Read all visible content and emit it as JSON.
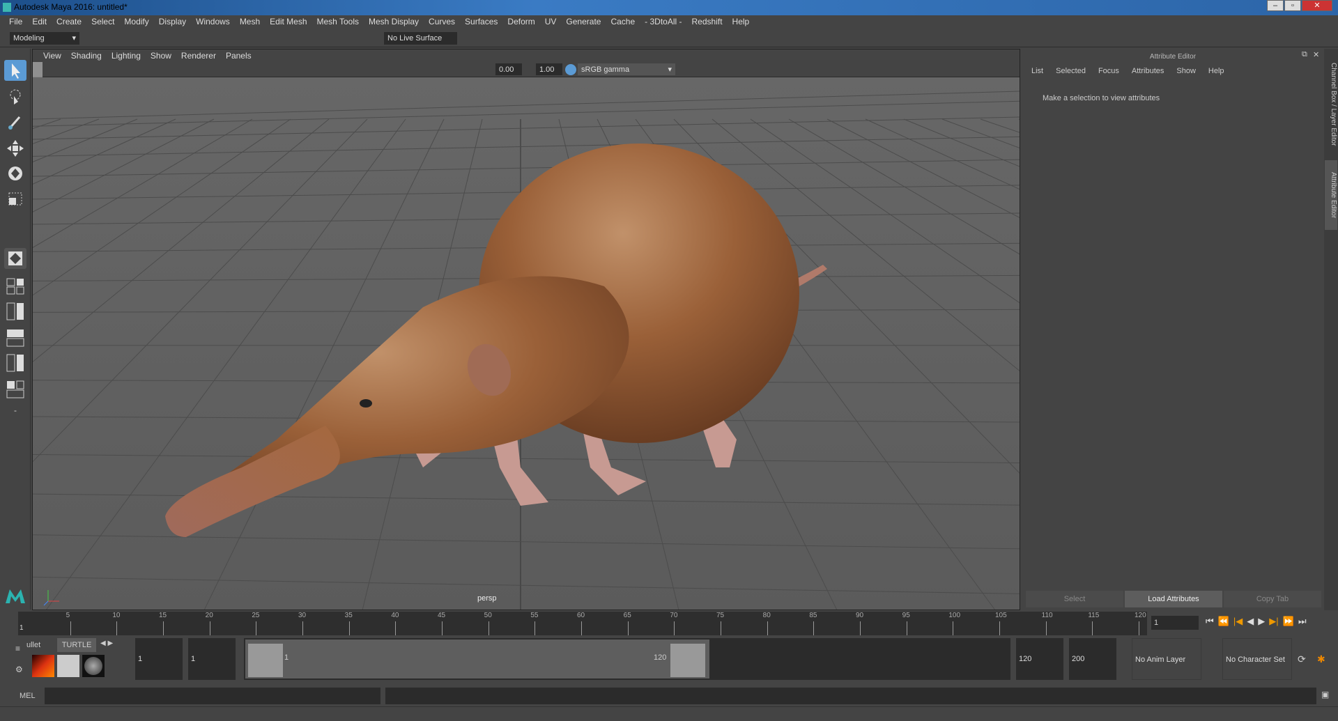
{
  "window": {
    "title": "Autodesk Maya 2016: untitled*",
    "minimize": "–",
    "maximize": "▫",
    "close": "✕"
  },
  "menubar": [
    "File",
    "Edit",
    "Create",
    "Select",
    "Modify",
    "Display",
    "Windows",
    "Mesh",
    "Edit Mesh",
    "Mesh Tools",
    "Mesh Display",
    "Curves",
    "Surfaces",
    "Deform",
    "UV",
    "Generate",
    "Cache",
    "- 3DtoAll -",
    "Redshift",
    "Help"
  ],
  "toolbar": {
    "mode": "Modeling",
    "live_surface": "No Live Surface"
  },
  "viewport": {
    "menu": [
      "View",
      "Shading",
      "Lighting",
      "Show",
      "Renderer",
      "Panels"
    ],
    "exposure": "0.00",
    "gamma": "1.00",
    "color_space": "sRGB gamma",
    "camera": "persp"
  },
  "attribute_editor": {
    "title": "Attribute Editor",
    "menu": [
      "List",
      "Selected",
      "Focus",
      "Attributes",
      "Show",
      "Help"
    ],
    "message": "Make a selection to view attributes",
    "buttons": {
      "select": "Select",
      "load": "Load Attributes",
      "copy": "Copy Tab"
    }
  },
  "side_tabs": [
    "Channel Box / Layer Editor",
    "Attribute Editor"
  ],
  "timeline": {
    "ticks": [
      "5",
      "10",
      "15",
      "20",
      "25",
      "30",
      "35",
      "40",
      "45",
      "50",
      "55",
      "60",
      "65",
      "70",
      "75",
      "80",
      "85",
      "90",
      "95",
      "100",
      "105",
      "110",
      "115",
      "120"
    ],
    "current_marker": "1",
    "current_frame": "1"
  },
  "shelf": {
    "tabs": [
      "ullet",
      "TURTLE"
    ]
  },
  "range": {
    "start": "1",
    "anim_start": "1",
    "slider_start": "1",
    "slider_end": "120",
    "end": "120",
    "anim_end": "200",
    "anim_layer": "No Anim Layer",
    "character_set": "No Character Set"
  },
  "mel": {
    "label": "MEL"
  },
  "colors": {
    "accent": "#5b9bd5",
    "bg": "#444444",
    "viewport": "#636363"
  }
}
